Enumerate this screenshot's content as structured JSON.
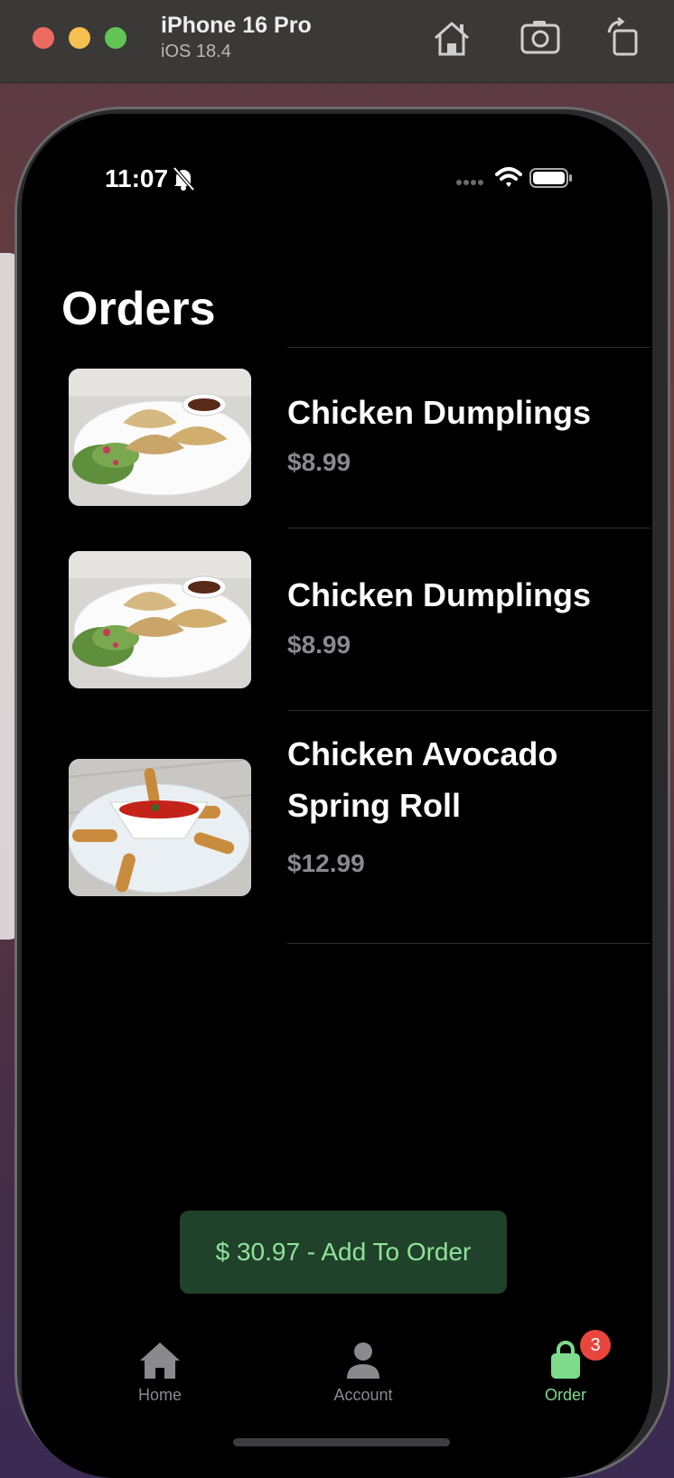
{
  "window": {
    "device_name": "iPhone 16 Pro",
    "os_version": "iOS 18.4",
    "buttons": [
      "home-icon",
      "screenshot-icon",
      "rotate-icon"
    ]
  },
  "status_bar": {
    "time": "11:07"
  },
  "page": {
    "title": "Orders"
  },
  "orders": [
    {
      "name": "Chicken Dumplings",
      "price": "$8.99",
      "image": "dumplings-photo"
    },
    {
      "name": "Chicken Dumplings",
      "price": "$8.99",
      "image": "dumplings-photo"
    },
    {
      "name": "Chicken Avocado Spring Roll",
      "price": "$12.99",
      "image": "spring-roll-photo"
    }
  ],
  "cta": {
    "label": "$ 30.97 - Add To Order"
  },
  "tab_bar": {
    "items": [
      {
        "label": "Home",
        "icon": "house-icon"
      },
      {
        "label": "Account",
        "icon": "person-icon"
      },
      {
        "label": "Order",
        "icon": "bag-icon",
        "badge": "3",
        "selected": true
      }
    ]
  },
  "colors": {
    "accent": "#7ddb8b",
    "cta_background": "#21422a",
    "badge": "#e8453c",
    "price": "#8a8a8e"
  }
}
